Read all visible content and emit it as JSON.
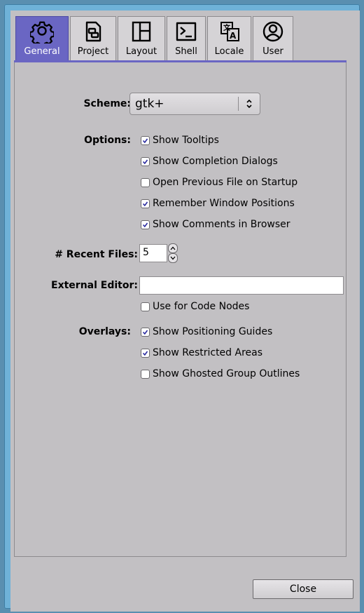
{
  "tabs": [
    {
      "label": "General",
      "icon": "gear-icon",
      "active": true
    },
    {
      "label": "Project",
      "icon": "project-icon",
      "active": false
    },
    {
      "label": "Layout",
      "icon": "layout-icon",
      "active": false
    },
    {
      "label": "Shell",
      "icon": "terminal-icon",
      "active": false
    },
    {
      "label": "Locale",
      "icon": "translate-icon",
      "active": false
    },
    {
      "label": "User",
      "icon": "user-icon",
      "active": false
    }
  ],
  "scheme": {
    "label": "Scheme:",
    "value": "gtk+"
  },
  "options": {
    "label": "Options:",
    "items": [
      {
        "label": "Show Tooltips",
        "checked": true
      },
      {
        "label": "Show Completion Dialogs",
        "checked": true
      },
      {
        "label": "Open Previous File on Startup",
        "checked": false
      },
      {
        "label": "Remember Window Positions",
        "checked": true
      },
      {
        "label": "Show Comments in Browser",
        "checked": true
      }
    ]
  },
  "recent_files": {
    "label": "# Recent Files:",
    "value": "5"
  },
  "external_editor": {
    "label": "External Editor:",
    "value": "",
    "use_for_code_nodes": {
      "label": "Use for Code Nodes",
      "checked": false
    }
  },
  "overlays": {
    "label": "Overlays:",
    "items": [
      {
        "label": "Show Positioning Guides",
        "checked": true
      },
      {
        "label": "Show Restricted Areas",
        "checked": true
      },
      {
        "label": "Show Ghosted Group Outlines",
        "checked": false
      }
    ]
  },
  "close_label": "Close",
  "colors": {
    "accent": "#6a66c3",
    "background": "#c2c0c3",
    "frame": "#6fb2d8"
  }
}
